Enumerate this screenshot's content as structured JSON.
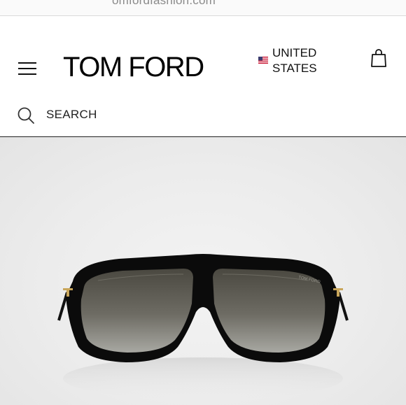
{
  "browser": {
    "url_partial": "omfordfashion.com"
  },
  "header": {
    "brand": "TOM FORD",
    "country": {
      "line1": "UNITED",
      "line2": "STATES"
    },
    "search": {
      "label": "SEARCH"
    }
  },
  "product": {
    "frame_brand_mark": "TOM FORD"
  },
  "icons": [
    "hamburger-menu-icon",
    "us-flag-icon",
    "shopping-bag-icon",
    "search-icon"
  ],
  "colors": {
    "brand": "#000000",
    "background": "#ffffff",
    "hero_background": "#ececec"
  }
}
